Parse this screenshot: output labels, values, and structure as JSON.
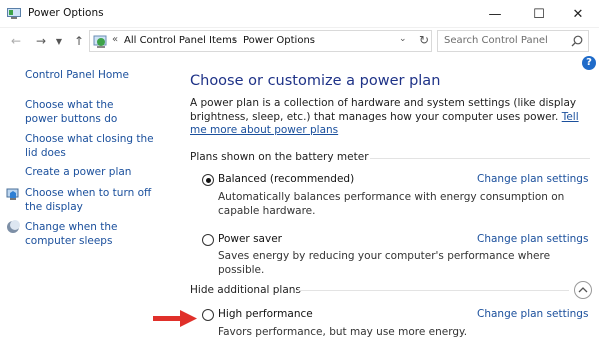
{
  "window": {
    "title": "Power Options",
    "minimize_glyph": "—",
    "maximize_glyph": "☐",
    "close_glyph": "✕"
  },
  "nav": {
    "back_icon": "arrow-left-icon",
    "forward_icon": "arrow-right-icon",
    "history_icon": "chevron-down-icon",
    "up_icon": "arrow-up-icon",
    "address": {
      "overflow": "«",
      "crumbs": [
        "All Control Panel Items",
        "Power Options"
      ],
      "separator": "›"
    },
    "refresh_icon": "refresh-icon",
    "search": {
      "placeholder": "Search Control Panel"
    }
  },
  "help": {
    "label": "?"
  },
  "sidebar": {
    "items": [
      {
        "label": "Control Panel Home"
      },
      {
        "label": "Choose what the power buttons do"
      },
      {
        "label": "Choose what closing the lid does"
      },
      {
        "label": "Create a power plan"
      },
      {
        "label": "Choose when to turn off the display",
        "icon": "monitor-shield-icon"
      },
      {
        "label": "Change when the computer sleeps",
        "icon": "moon-icon"
      }
    ]
  },
  "main": {
    "title": "Choose or customize a power plan",
    "description": "A power plan is a collection of hardware and system settings (like display brightness, sleep, etc.) that manages how your computer uses power.",
    "description_link": "Tell me more about power plans",
    "section_battery": "Plans shown on the battery meter",
    "section_hidden": "Hide additional plans",
    "plans": [
      {
        "name": "Balanced (recommended)",
        "description": "Automatically balances performance with energy consumption on capable hardware.",
        "link": "Change plan settings",
        "selected": true
      },
      {
        "name": "Power saver",
        "description": "Saves energy by reducing your computer's performance where possible.",
        "link": "Change plan settings",
        "selected": false
      },
      {
        "name": "High performance",
        "description": "Favors performance, but may use more energy.",
        "link": "Change plan settings",
        "selected": false
      }
    ]
  },
  "colors": {
    "accent_red": "#e0302a",
    "link_blue": "#1a4f9c",
    "title_blue": "#1e3287"
  }
}
